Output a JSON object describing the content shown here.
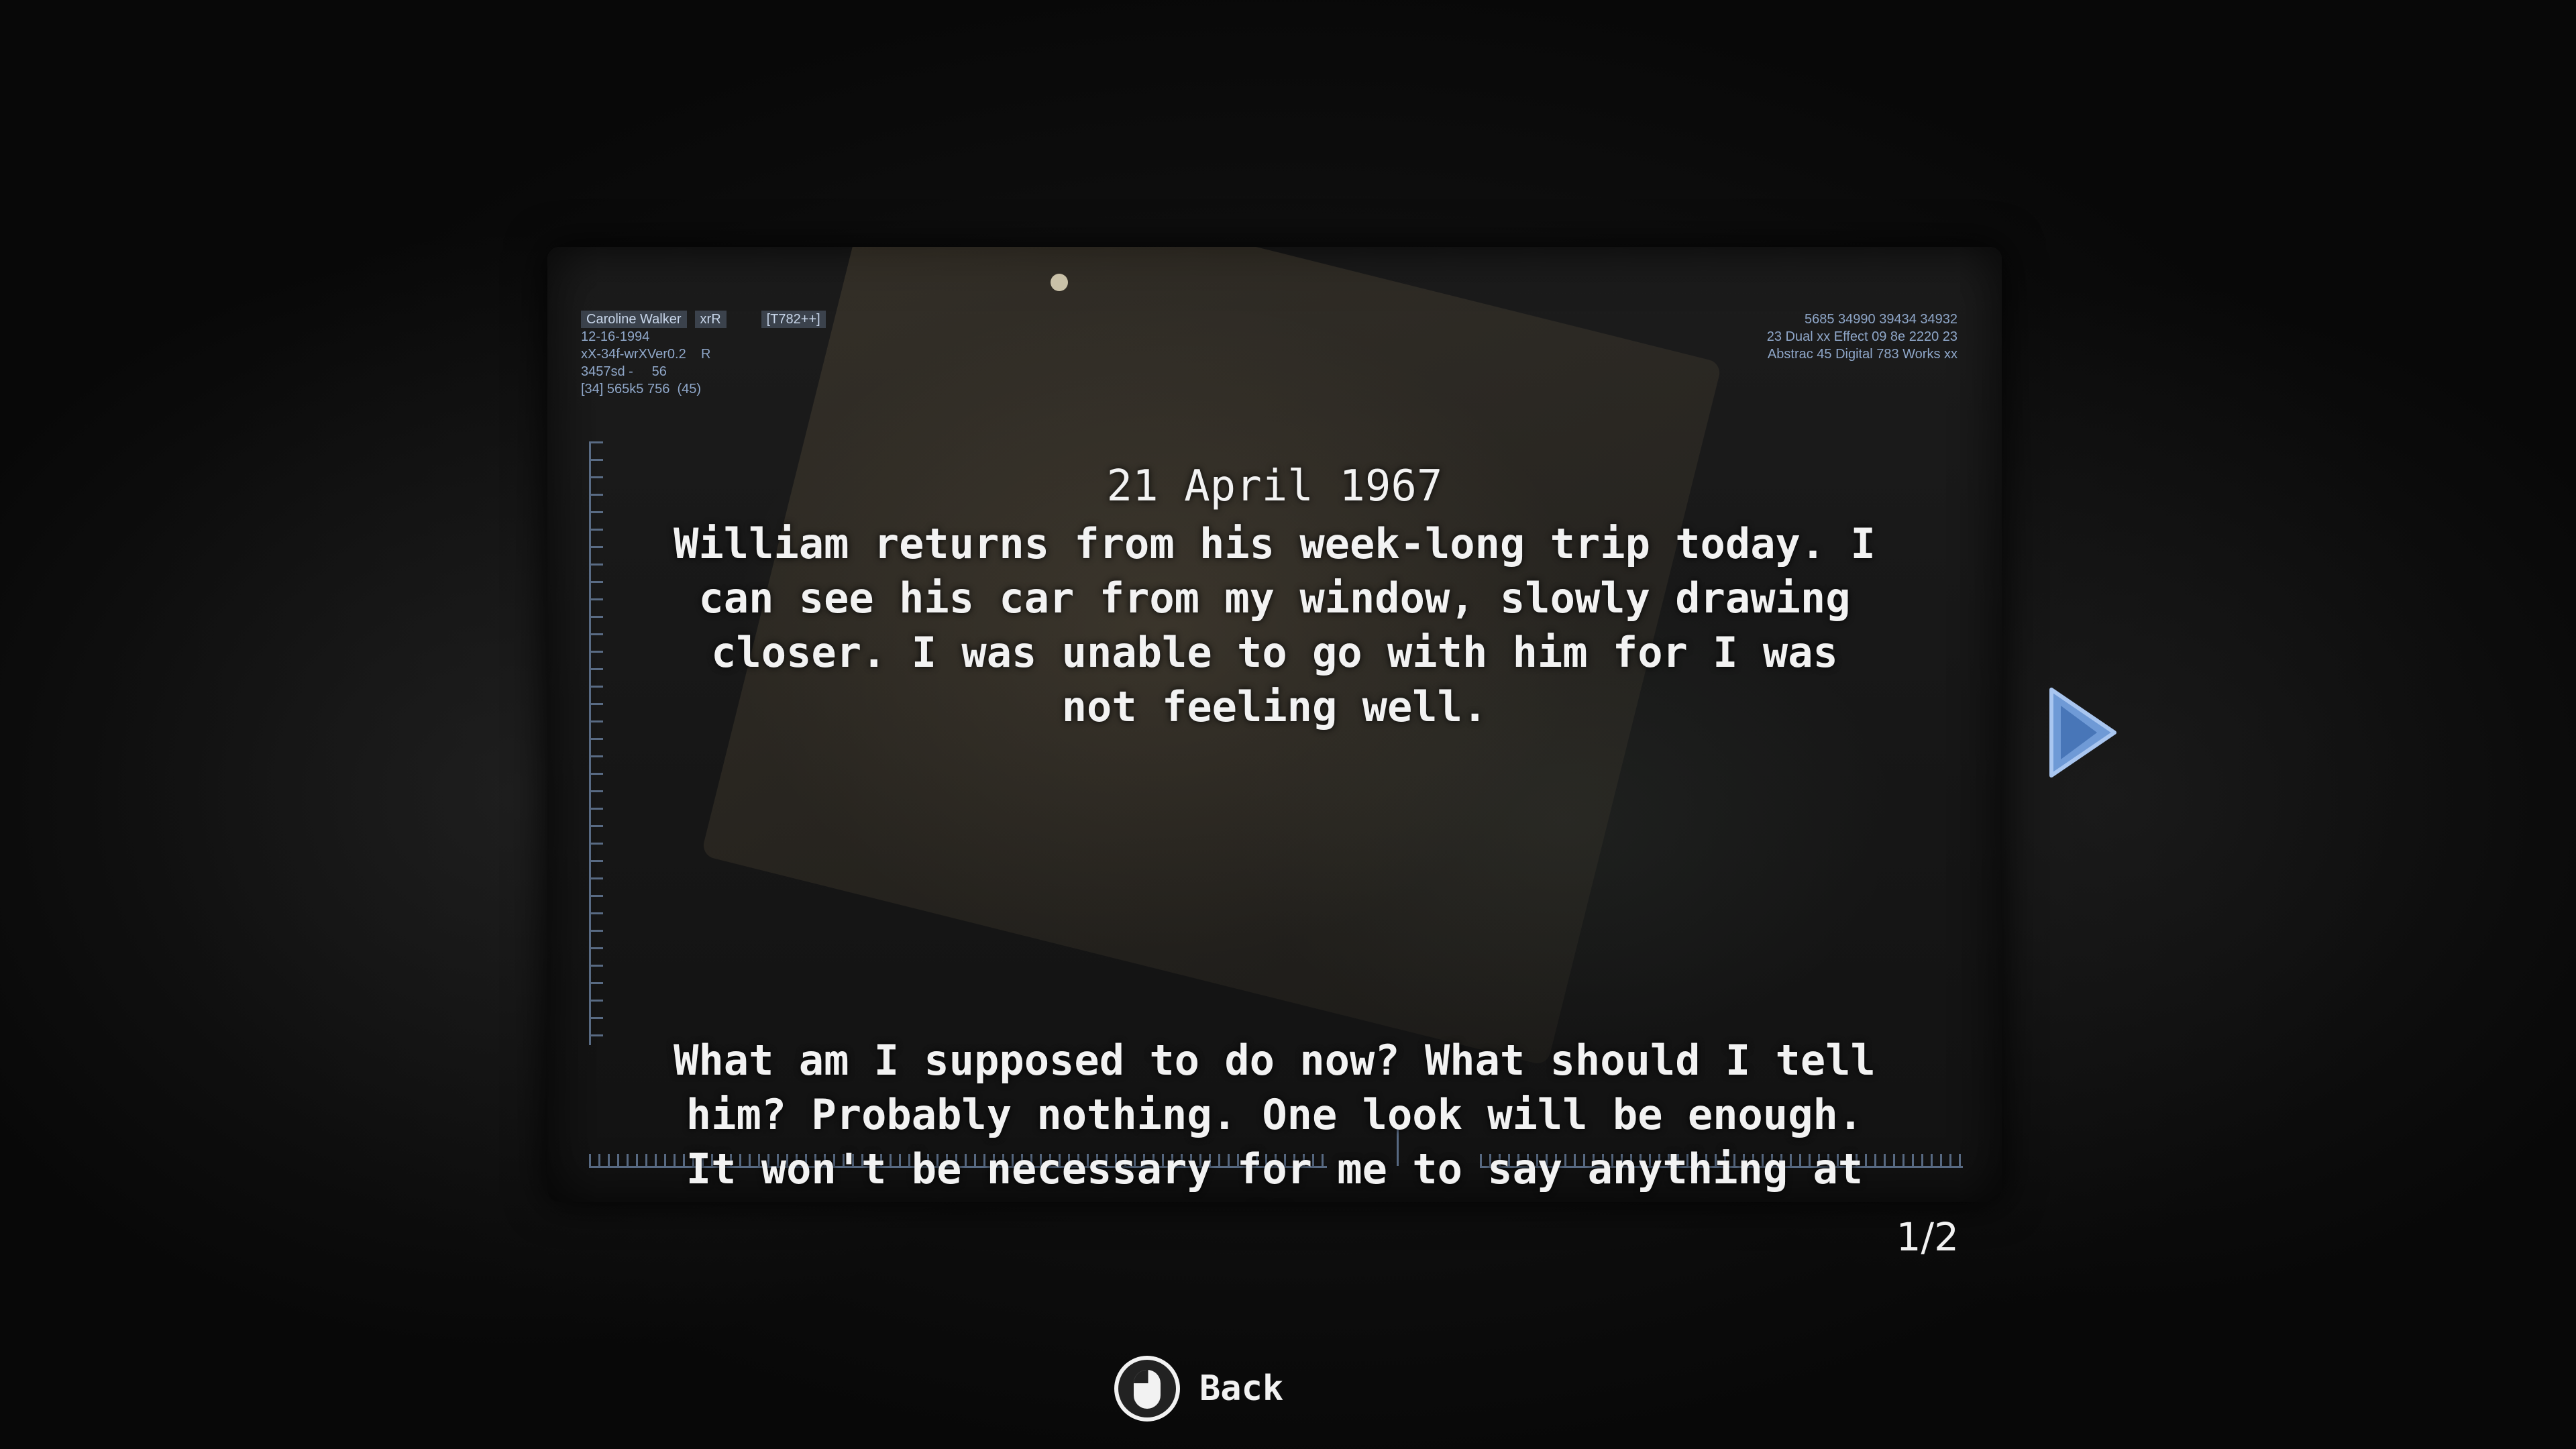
{
  "document": {
    "date": "21 April 1967",
    "paragraph1": "William returns from his week-long trip today. I can see his car from my window, slowly drawing closer. I was unable to go with him for I was not feeling well.",
    "paragraph2": "What am I supposed to do now? What should I tell him? Probably nothing. One look will be enough. It won't be necessary for me to say anything at all."
  },
  "hud_left": {
    "name": "Caroline Walker",
    "tag": "xrR",
    "code": "[T782++]",
    "line2": "12-16-1994",
    "line3": "xX-34f-wrXVer0.2    R",
    "line4": "3457sd -     56",
    "line5": "[34] 565k5 756  (45)"
  },
  "hud_right": {
    "line1": "5685 34990 39434 34932",
    "line2": "23 Dual  xx Effect 09 8e 2220 23",
    "line3": "Abstrac 45 Digital 783 Works xx"
  },
  "pagination": {
    "counter": "1/2"
  },
  "controls": {
    "back_label": "Back",
    "mouse_icon": "mouse-left-click-icon",
    "next_icon": "next-page-arrow-icon"
  },
  "colors": {
    "text": "#f2f2f2",
    "hud_blue": "#8fa7c9",
    "arrow_blue": "#5b86c4"
  }
}
